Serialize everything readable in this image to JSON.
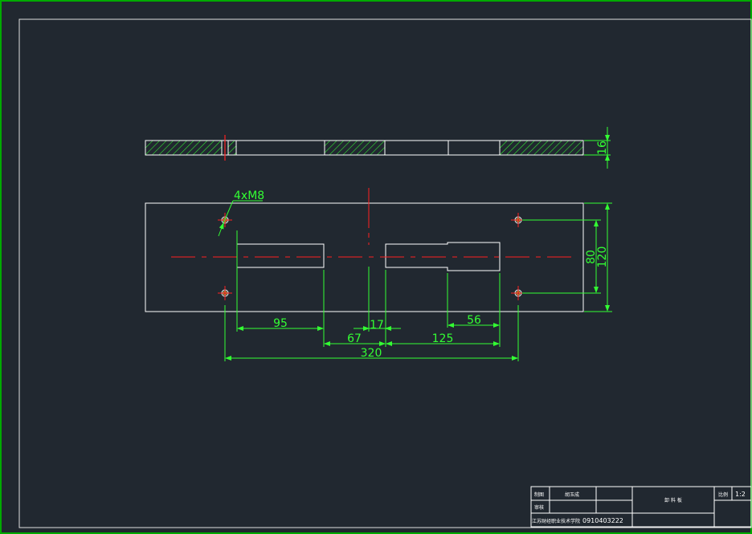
{
  "drawing": {
    "callout": "4xM8",
    "dimensions": {
      "d95": "95",
      "d17": "17",
      "d56": "56",
      "d67": "67",
      "d125": "125",
      "d320": "320",
      "d80": "80",
      "d120": "120",
      "d16": "16"
    }
  },
  "title_block": {
    "drawn_label": "制图",
    "drawn_name": "胡玉成",
    "checked_label": "审核",
    "school": "江苏财经职业技术学院",
    "drawing_number": "0910403222",
    "part_name": "卸 料 板",
    "scale_label": "比例",
    "scale_value": "1:2"
  },
  "colors": {
    "background": "#212830",
    "outline": "#ffffff",
    "dimension": "#33ff33",
    "centerline": "#ff2020",
    "hatch": "#33ff33",
    "border": "#ffffff",
    "frame": "#00aa00"
  }
}
